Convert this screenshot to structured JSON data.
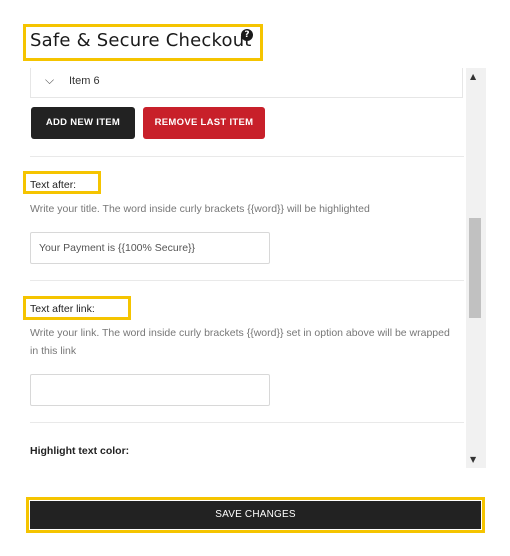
{
  "header": {
    "title": "Safe & Secure Checkout",
    "help_glyph": "?"
  },
  "items": {
    "current_label": "Item 6"
  },
  "buttons": {
    "add": "ADD NEW ITEM",
    "remove": "REMOVE LAST ITEM",
    "save": "SAVE CHANGES"
  },
  "fields": {
    "text_after": {
      "label": "Text after:",
      "description": "Write your title. The word inside curly brackets {{word}} will be highlighted",
      "value": "Your Payment is {{100% Secure}}"
    },
    "text_after_link": {
      "label": "Text after link:",
      "description": "Write your link. The word inside curly brackets {{word}} set in option above will be wrapped in this link",
      "value": ""
    },
    "highlight_color": {
      "label": "Highlight text color:"
    }
  },
  "colors": {
    "highlight_box": "#f5c400",
    "remove_button": "#c8202a",
    "dark_button": "#222222"
  }
}
